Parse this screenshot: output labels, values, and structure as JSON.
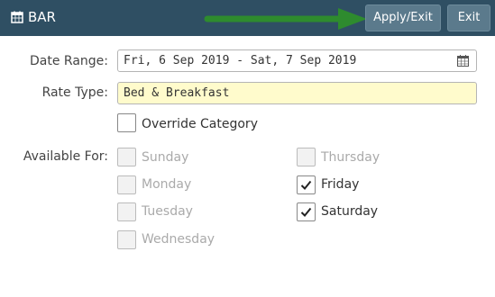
{
  "header": {
    "title": "BAR",
    "apply_label": "Apply/Exit",
    "exit_label": "Exit",
    "bg_color": "#2f4f63",
    "arrow_color": "#2e8b2e"
  },
  "form": {
    "date_range_label": "Date Range:",
    "date_range_value": "Fri, 6 Sep 2019 - Sat, 7 Sep 2019",
    "rate_type_label": "Rate Type:",
    "rate_type_value": "Bed & Breakfast",
    "override_label": "Override Category",
    "available_for_label": "Available For:"
  },
  "days": [
    {
      "name": "Sunday",
      "checked": false,
      "enabled": false
    },
    {
      "name": "Monday",
      "checked": false,
      "enabled": false
    },
    {
      "name": "Tuesday",
      "checked": false,
      "enabled": false
    },
    {
      "name": "Wednesday",
      "checked": false,
      "enabled": false
    },
    {
      "name": "Thursday",
      "checked": false,
      "enabled": false
    },
    {
      "name": "Friday",
      "checked": true,
      "enabled": true
    },
    {
      "name": "Saturday",
      "checked": true,
      "enabled": true
    }
  ]
}
